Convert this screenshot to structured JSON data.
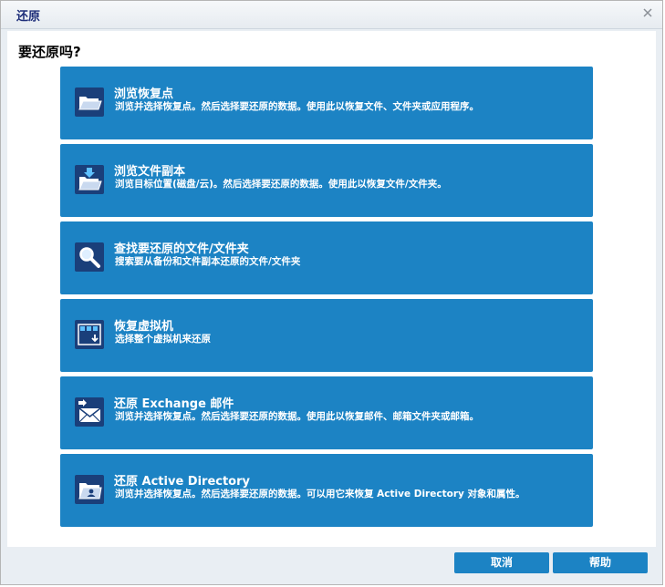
{
  "window": {
    "title": "还原",
    "close_icon": "close-icon"
  },
  "question": "要还原吗?",
  "options": [
    {
      "title": "浏览恢复点",
      "description": "浏览并选择恢复点。然后选择要还原的数据。使用此以恢复文件、文件夹或应用程序。",
      "icon": "open-folder-icon"
    },
    {
      "title": "浏览文件副本",
      "description": "浏览目标位置(磁盘/云)。然后选择要还原的数据。使用此以恢复文件/文件夹。",
      "icon": "folder-download-icon"
    },
    {
      "title": "查找要还原的文件/文件夹",
      "description": "搜索要从备份和文件副本还原的文件/文件夹",
      "icon": "search-icon"
    },
    {
      "title": "恢复虚拟机",
      "description": "选择整个虚拟机来还原",
      "icon": "virtual-machine-icon"
    },
    {
      "title": "还原 Exchange 邮件",
      "description": "浏览并选择恢复点。然后选择要还原的数据。使用此以恢复邮件、邮箱文件夹或邮箱。",
      "icon": "mail-icon"
    },
    {
      "title": "还原 Active Directory",
      "description": "浏览并选择恢复点。然后选择要还原的数据。可以用它来恢复 Active Directory 对象和属性。",
      "icon": "directory-icon"
    }
  ],
  "footer": {
    "cancel_label": "取消",
    "help_label": "帮助"
  },
  "colors": {
    "accent": "#1c83c4",
    "title_text": "#1f2f7a",
    "icon_bg": "#1a3f7a"
  }
}
